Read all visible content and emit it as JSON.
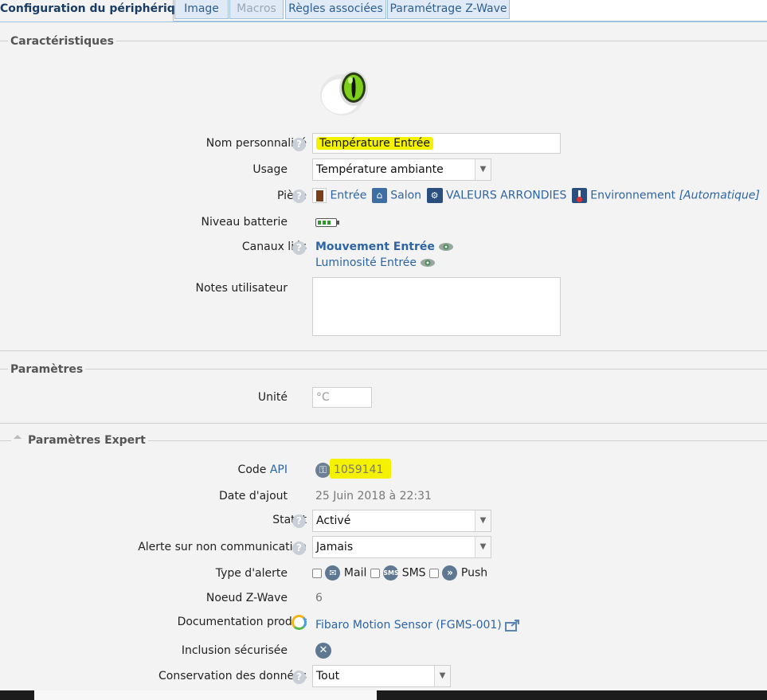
{
  "tabs": [
    {
      "label": "Configuration du périphérique"
    },
    {
      "label": "Image"
    },
    {
      "label": "Macros"
    },
    {
      "label": "Règles associées"
    },
    {
      "label": "Paramétrage Z-Wave"
    }
  ],
  "sections": {
    "caracteristiques": "Caractéristiques",
    "parametres": "Paramètres",
    "expert": "Paramètres Expert"
  },
  "device": {
    "icon": "cat-eye-sensor-icon",
    "name_label": "Nom personnalisé",
    "name_value": "Température Entrée",
    "usage_label": "Usage",
    "usage_value": "Température ambiante",
    "piece_label": "Pièce",
    "piece": {
      "room1": "Entrée",
      "room2": "Salon",
      "room3": "VALEURS ARRONDIES",
      "room4": "Environnement",
      "auto": "[Automatique]"
    },
    "battery_label": "Niveau batterie",
    "channels_label": "Canaux liés",
    "channel1": "Mouvement Entrée",
    "channel2": "Luminosité Entrée",
    "notes_label": "Notes utilisateur",
    "notes_value": ""
  },
  "params": {
    "unit_label": "Unité",
    "unit_placeholder": "°C"
  },
  "expert": {
    "code_label": "Code",
    "code_api": "API",
    "code_value": "1059141",
    "date_label": "Date d'ajout",
    "date_value": "25 Juin 2018 à 22:31",
    "statut_label": "Statut",
    "statut_value": "Activé",
    "alerte_label": "Alerte sur non communication",
    "alerte_value": "Jamais",
    "type_label": "Type d'alerte",
    "type_mail": "Mail",
    "type_sms": "SMS",
    "type_sms_icon": "SMS",
    "type_push": "Push",
    "noeud_label": "Noeud Z-Wave",
    "noeud_value": "6",
    "doc_label": "Documentation produit",
    "doc_value": "Fibaro Motion Sensor (FGMS-001)",
    "inclusion_label": "Inclusion sécurisée",
    "conservation_label": "Conservation des données",
    "conservation_value": "Tout"
  },
  "colors": {
    "link": "#2d64a5",
    "highlight": "#f4f200",
    "tab_border": "#9ebfdc"
  }
}
